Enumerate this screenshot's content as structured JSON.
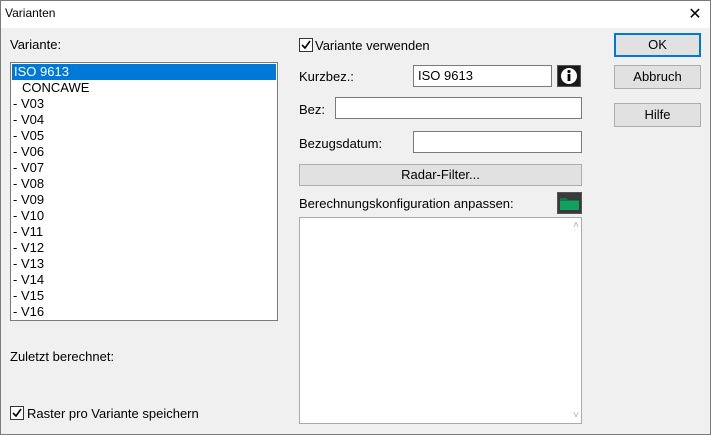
{
  "window": {
    "title": "Varianten",
    "close_glyph": "✕"
  },
  "variant_label": "Variante:",
  "variants": [
    {
      "label": "ISO 9613",
      "selected": true
    },
    {
      "label": "CONCAWE"
    },
    {
      "label": "- V03"
    },
    {
      "label": "- V04"
    },
    {
      "label": "- V05"
    },
    {
      "label": "- V06"
    },
    {
      "label": "- V07"
    },
    {
      "label": "- V08"
    },
    {
      "label": "- V09"
    },
    {
      "label": "- V10"
    },
    {
      "label": "- V11"
    },
    {
      "label": "- V12"
    },
    {
      "label": "- V13"
    },
    {
      "label": "- V14"
    },
    {
      "label": "- V15"
    },
    {
      "label": "- V16"
    }
  ],
  "zuletzt_label": "Zuletzt berechnet:",
  "raster_checkbox": {
    "label": "Raster pro Variante speichern",
    "checked": true
  },
  "use_variant_checkbox": {
    "label": "Variante verwenden",
    "checked": true
  },
  "kurzbez": {
    "label": "Kurzbez.:",
    "value": "ISO 9613"
  },
  "bez": {
    "label": "Bez:",
    "value": ""
  },
  "bezugsdatum": {
    "label": "Bezugsdatum:",
    "value": ""
  },
  "radar_button": "Radar-Filter...",
  "config_label": "Berechnungskonfiguration anpassen:",
  "buttons": {
    "ok": "OK",
    "cancel": "Abbruch",
    "help": "Hilfe"
  },
  "icons": {
    "info": "info-icon",
    "folder": "folder-icon"
  },
  "colors": {
    "selection": "#0078d7",
    "button_face": "#e1e1e1",
    "folder": "#0a7a4a"
  }
}
